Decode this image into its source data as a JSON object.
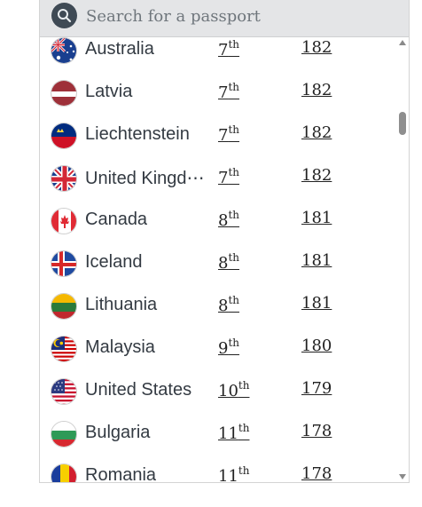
{
  "search": {
    "placeholder": "Search for a passport"
  },
  "rows": [
    {
      "country": "Australia",
      "rank_num": "7",
      "rank_suffix": "th",
      "score": "182",
      "flag": "australia-flag-icon"
    },
    {
      "country": "Latvia",
      "rank_num": "7",
      "rank_suffix": "th",
      "score": "182",
      "flag": "latvia-flag-icon"
    },
    {
      "country": "Liechtenstein",
      "rank_num": "7",
      "rank_suffix": "th",
      "score": "182",
      "flag": "liechtenstein-flag-icon"
    },
    {
      "country": "United Kingd⋯",
      "rank_num": "7",
      "rank_suffix": "th",
      "score": "182",
      "flag": "united-kingdom-flag-icon"
    },
    {
      "country": "Canada",
      "rank_num": "8",
      "rank_suffix": "th",
      "score": "181",
      "flag": "canada-flag-icon"
    },
    {
      "country": "Iceland",
      "rank_num": "8",
      "rank_suffix": "th",
      "score": "181",
      "flag": "iceland-flag-icon"
    },
    {
      "country": "Lithuania",
      "rank_num": "8",
      "rank_suffix": "th",
      "score": "181",
      "flag": "lithuania-flag-icon"
    },
    {
      "country": "Malaysia",
      "rank_num": "9",
      "rank_suffix": "th",
      "score": "180",
      "flag": "malaysia-flag-icon"
    },
    {
      "country": "United States",
      "rank_num": "10",
      "rank_suffix": "th",
      "score": "179",
      "flag": "united-states-flag-icon"
    },
    {
      "country": "Bulgaria",
      "rank_num": "11",
      "rank_suffix": "th",
      "score": "178",
      "flag": "bulgaria-flag-icon"
    },
    {
      "country": "Romania",
      "rank_num": "11",
      "rank_suffix": "th",
      "score": "178",
      "flag": "romania-flag-icon"
    }
  ],
  "colors": {
    "search_bg": "#e4e5e7",
    "search_icon_bg": "#3f4a55",
    "text": "#333a42"
  }
}
